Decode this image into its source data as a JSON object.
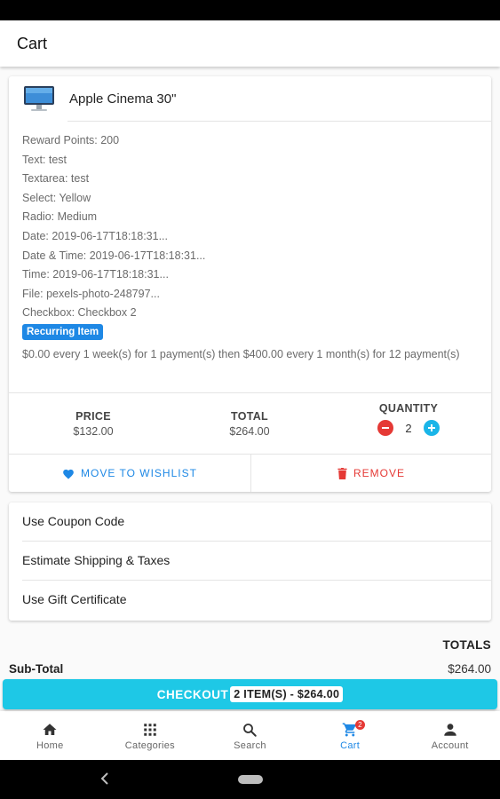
{
  "header": {
    "title": "Cart"
  },
  "product": {
    "name": "Apple Cinema 30\"",
    "options": [
      "Reward Points: 200",
      "Text: test",
      "Textarea: test",
      "Select: Yellow",
      "Radio: Medium",
      "Date: 2019-06-17T18:18:31...",
      "Date & Time: 2019-06-17T18:18:31...",
      "Time: 2019-06-17T18:18:31...",
      "File: pexels-photo-248797...",
      "Checkbox: Checkbox 2"
    ],
    "recurring_badge": "Recurring Item",
    "recurring_text": "$0.00 every 1 week(s) for 1 payment(s) then $400.00 every 1 month(s) for 12 payment(s)",
    "price_label": "PRICE",
    "price_value": "$132.00",
    "total_label": "TOTAL",
    "total_value": "$264.00",
    "quantity_label": "QUANTITY",
    "quantity_value": "2",
    "wishlist_label": "MOVE TO WISHLIST",
    "remove_label": "REMOVE"
  },
  "links": [
    {
      "label": "Use Coupon Code"
    },
    {
      "label": "Estimate Shipping & Taxes"
    },
    {
      "label": "Use Gift Certificate"
    }
  ],
  "totals": {
    "heading": "TOTALS",
    "subtotal_label": "Sub-Total",
    "subtotal_value": "$264.00"
  },
  "checkout": {
    "label": "CHECKOUT",
    "summary": "2 ITEM(S) - $264.00"
  },
  "bottom_nav": {
    "items": [
      {
        "label": "Home",
        "icon": "home-icon"
      },
      {
        "label": "Categories",
        "icon": "grid-icon"
      },
      {
        "label": "Search",
        "icon": "search-icon"
      },
      {
        "label": "Cart",
        "icon": "cart-icon",
        "badge": "2"
      },
      {
        "label": "Account",
        "icon": "account-icon"
      }
    ],
    "active": "Cart"
  },
  "colors": {
    "accent": "#1ec8e6",
    "primary": "#1e88e5",
    "danger": "#e53935"
  }
}
